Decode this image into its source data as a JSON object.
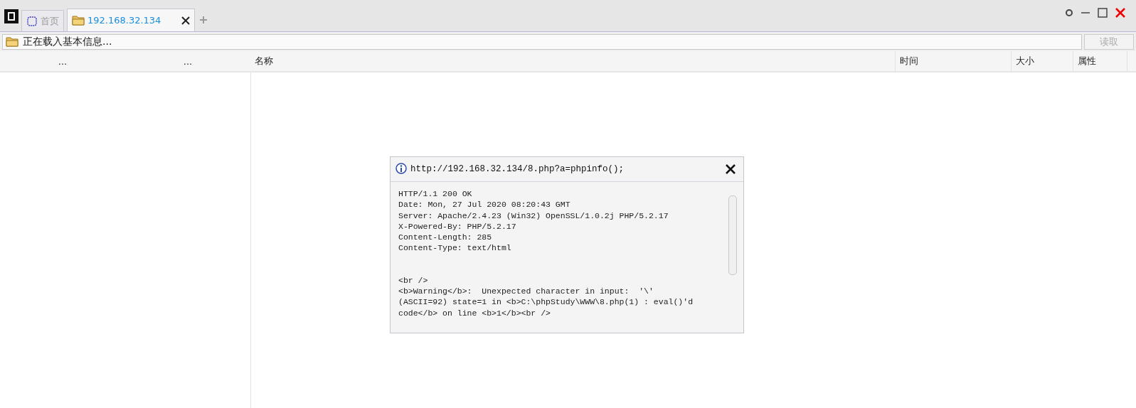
{
  "tabs": [
    {
      "label": "首页",
      "kind": "home",
      "selected": false
    },
    {
      "label": "192.168.32.134",
      "kind": "folder",
      "selected": true
    }
  ],
  "window_controls": [
    {
      "kind": "pin"
    },
    {
      "kind": "minimize"
    },
    {
      "kind": "maximize"
    },
    {
      "kind": "close"
    }
  ],
  "address_bar": {
    "value": "正在载入基本信息...",
    "button": "读取",
    "button_disabled": true
  },
  "columns": [
    {
      "label": "..."
    },
    {
      "label": "..."
    },
    {
      "label": "名称"
    },
    {
      "label": "时间"
    },
    {
      "label": "大小"
    },
    {
      "label": "属性"
    }
  ],
  "dialog": {
    "title": "http://192.168.32.134/8.php?a=phpinfo();",
    "headers": [
      "HTTP/1.1 200 OK",
      "Date: Mon, 27 Jul 2020 08:20:43 GMT",
      "Server: Apache/2.4.23 (Win32) OpenSSL/1.0.2j PHP/5.2.17",
      "X-Powered-By: PHP/5.2.17",
      "Content-Length: 285",
      "Content-Type: text/html"
    ],
    "body": [
      "<br />",
      "<b>Warning</b>:  Unexpected character in input:  '\\'",
      "(ASCII=92) state=1 in <b>C:\\phpStudy\\WWW\\8.php(1) : eval()'d",
      "code</b> on line <b>1</b><br />"
    ]
  }
}
